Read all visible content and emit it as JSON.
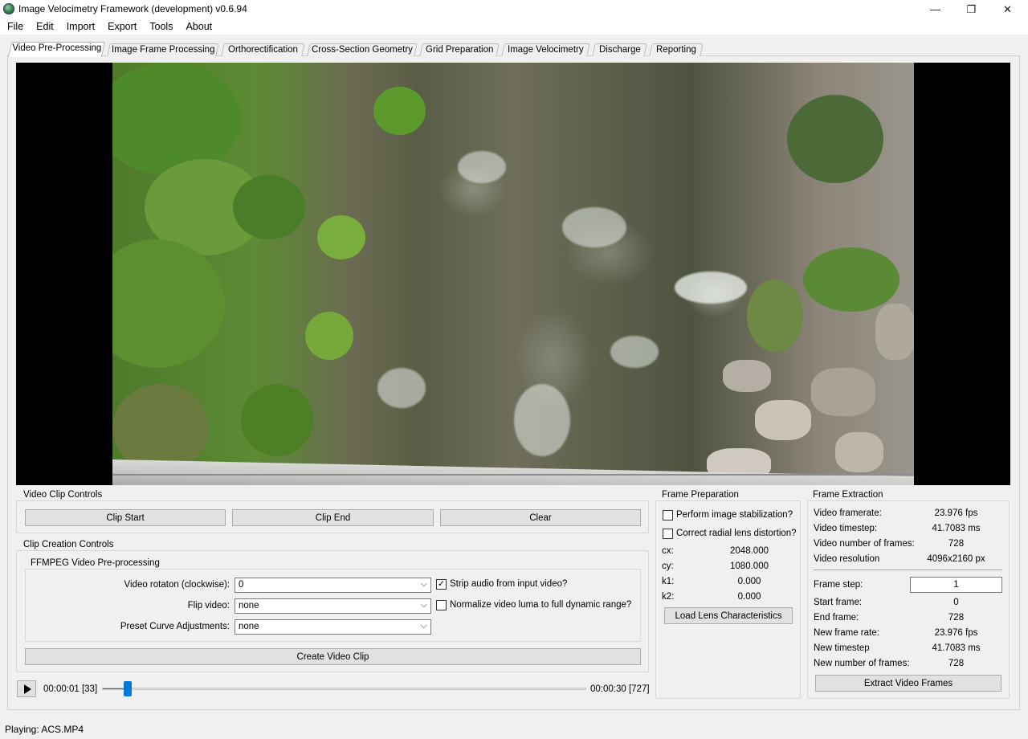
{
  "window": {
    "title": "Image Velocimetry Framework (development) v0.6.94",
    "minimize_icon": "minimize-icon",
    "maximize_icon": "restore-icon",
    "close_icon": "close-icon",
    "min_glyph": "—",
    "max_glyph": "❐",
    "close_glyph": "✕"
  },
  "menu": [
    "File",
    "Edit",
    "Import",
    "Export",
    "Tools",
    "About"
  ],
  "tabs": [
    {
      "label": "Video Pre-Processing",
      "active": true
    },
    {
      "label": "Image Frame Processing",
      "active": false
    },
    {
      "label": "Orthorectification",
      "active": false
    },
    {
      "label": "Cross-Section Geometry",
      "active": false
    },
    {
      "label": "Grid Preparation",
      "active": false
    },
    {
      "label": "Image Velocimetry",
      "active": false
    },
    {
      "label": "Discharge",
      "active": false
    },
    {
      "label": "Reporting",
      "active": false
    }
  ],
  "video_clip_controls": {
    "title": "Video Clip Controls",
    "clip_start": "Clip Start",
    "clip_end": "Clip End",
    "clear": "Clear"
  },
  "clip_creation": {
    "title": "Clip Creation Controls",
    "ffmpeg_title": "FFMPEG Video Pre-processing",
    "rotation_label": "Video rotaton (clockwise):",
    "rotation_value": "0",
    "flip_label": "Flip video:",
    "flip_value": "none",
    "curve_label": "Preset Curve Adjustments:",
    "curve_value": "none",
    "strip_audio_label": "Strip audio from input video?",
    "strip_audio_checked": true,
    "normalize_label": "Normalize video luma to full dynamic range?",
    "normalize_checked": false,
    "create_button": "Create Video Clip"
  },
  "frame_preparation": {
    "title": "Frame Preparation",
    "stabilization_label": "Perform image stabilization?",
    "stabilization_checked": false,
    "lens_label": "Correct radial lens distortion?",
    "lens_checked": false,
    "params": [
      {
        "label": "cx:",
        "value": "2048.000"
      },
      {
        "label": "cy:",
        "value": "1080.000"
      },
      {
        "label": "k1:",
        "value": "0.000"
      },
      {
        "label": "k2:",
        "value": "0.000"
      }
    ],
    "load_button": "Load Lens Characteristics"
  },
  "frame_extraction": {
    "title": "Frame Extraction",
    "info": [
      {
        "label": "Video framerate:",
        "value": "23.976 fps"
      },
      {
        "label": "Video timestep:",
        "value": "41.7083 ms"
      },
      {
        "label": "Video number of frames:",
        "value": "728"
      },
      {
        "label": "Video resolution",
        "value": "4096x2160 px"
      }
    ],
    "frame_step_label": "Frame step:",
    "frame_step_value": "1",
    "details": [
      {
        "label": "Start frame:",
        "value": "0"
      },
      {
        "label": "End frame:",
        "value": "728"
      },
      {
        "label": "New frame rate:",
        "value": "23.976 fps"
      },
      {
        "label": "New timestep",
        "value": "41.7083 ms"
      },
      {
        "label": "New number of frames:",
        "value": "728"
      }
    ],
    "extract_button": "Extract Video Frames"
  },
  "player": {
    "current_time": "00:00:01 [33]",
    "end_time": "00:00:30 [727]",
    "position_fraction": 0.045,
    "play_icon": "play-icon",
    "accent": "#0078d7"
  },
  "status": {
    "text": "Playing: ACS.MP4"
  }
}
